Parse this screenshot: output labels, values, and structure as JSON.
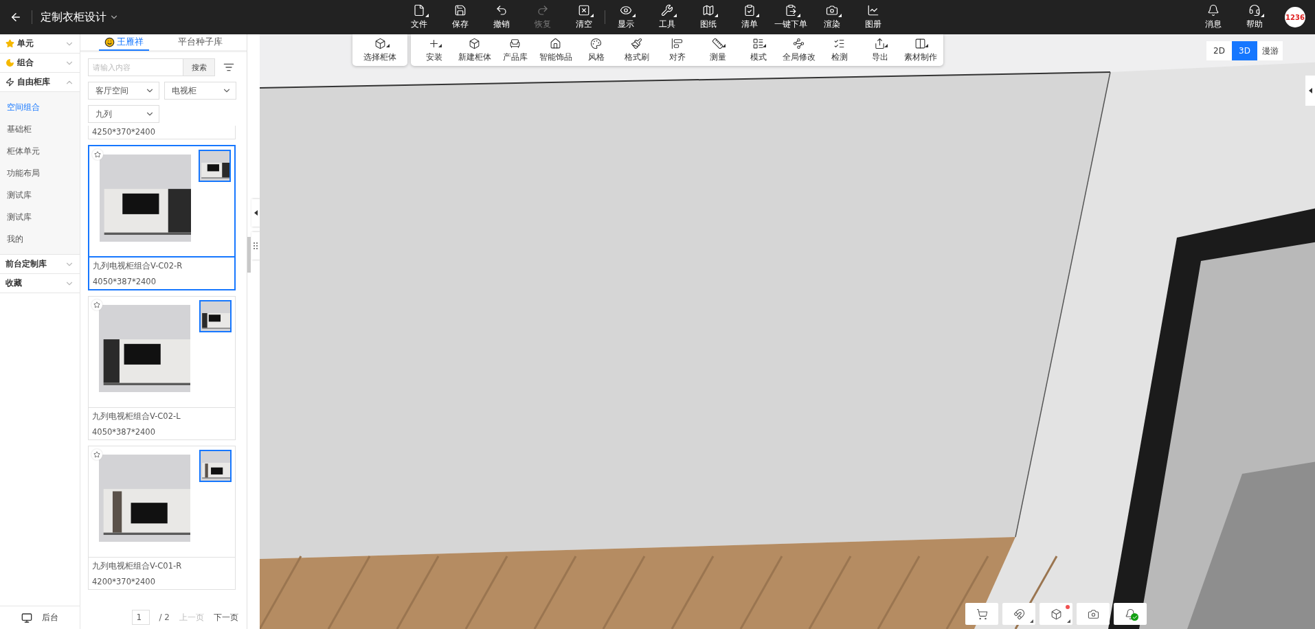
{
  "header": {
    "title": "定制衣柜设计",
    "menu_groups": [
      [
        {
          "label": "文件",
          "has_menu": true,
          "disabled": false
        },
        {
          "label": "保存",
          "has_menu": false,
          "disabled": false
        },
        {
          "label": "撤销",
          "has_menu": false,
          "disabled": false
        },
        {
          "label": "恢复",
          "has_menu": false,
          "disabled": true
        },
        {
          "label": "清空",
          "has_menu": true,
          "disabled": false
        }
      ],
      [
        {
          "label": "显示",
          "has_menu": true,
          "disabled": false
        },
        {
          "label": "工具",
          "has_menu": true,
          "disabled": false
        },
        {
          "label": "图纸",
          "has_menu": true,
          "disabled": false
        },
        {
          "label": "清单",
          "has_menu": true,
          "disabled": false
        },
        {
          "label": "一键下单",
          "has_menu": true,
          "disabled": false
        },
        {
          "label": "渲染",
          "has_menu": true,
          "disabled": false
        },
        {
          "label": "图册",
          "has_menu": false,
          "disabled": false
        }
      ]
    ],
    "right": [
      {
        "label": "消息",
        "has_menu": false
      },
      {
        "label": "帮助",
        "has_menu": true
      }
    ],
    "avatar": "1236"
  },
  "nav": {
    "sections": [
      {
        "label": "单元",
        "expanded": false
      },
      {
        "label": "组合",
        "expanded": false
      },
      {
        "label": "自由柜库",
        "expanded": true,
        "children": [
          {
            "label": "空间组合",
            "selected": true
          },
          {
            "label": "基础柜",
            "selected": false
          },
          {
            "label": "柜体单元",
            "selected": false
          },
          {
            "label": "功能布局",
            "selected": false
          },
          {
            "label": "测试库",
            "selected": false
          },
          {
            "label": "测试库",
            "selected": false
          },
          {
            "label": "我的",
            "selected": false
          }
        ]
      },
      {
        "label": "前台定制库",
        "expanded": false
      },
      {
        "label": "收藏",
        "expanded": false
      }
    ],
    "footer": "后台"
  },
  "library": {
    "tabs": [
      {
        "label": "王雁祥",
        "selected": true
      },
      {
        "label": "平台种子库",
        "selected": false
      }
    ],
    "search": {
      "placeholder": "请输入内容",
      "button": "搜索"
    },
    "filters": [
      "客厅空间",
      "电视柜",
      "九列"
    ],
    "partial_card": {
      "dims": "4250*370*2400"
    },
    "cards": [
      {
        "name": "九列电视柜组合V-C02-R",
        "dims": "4050*387*2400",
        "selected": true
      },
      {
        "name": "九列电视柜组合V-C02-L",
        "dims": "4050*387*2400",
        "selected": false
      },
      {
        "name": "九列电视柜组合V-C01-R",
        "dims": "4200*370*2400",
        "selected": false
      }
    ],
    "pagination": {
      "page": "1",
      "total": "/ 2",
      "prev": {
        "label": "上一页",
        "disabled": true
      },
      "next": {
        "label": "下一页",
        "disabled": false
      }
    }
  },
  "toolbar": {
    "groups": [
      [
        {
          "label": "选择柜体",
          "has_menu": true
        }
      ],
      [
        {
          "label": "安装",
          "has_menu": true
        },
        {
          "label": "新建柜体",
          "has_menu": false
        },
        {
          "label": "产品库",
          "has_menu": false
        },
        {
          "label": "智能饰品",
          "has_menu": false
        },
        {
          "label": "风格",
          "has_menu": false
        },
        {
          "label": "格式刷",
          "has_menu": false
        },
        {
          "label": "对齐",
          "has_menu": false
        },
        {
          "label": "测量",
          "has_menu": true
        },
        {
          "label": "模式",
          "has_menu": true
        },
        {
          "label": "全局修改",
          "has_menu": false
        },
        {
          "label": "检测",
          "has_menu": false
        },
        {
          "label": "导出",
          "has_menu": true
        },
        {
          "label": "素材制作",
          "has_menu": true
        }
      ]
    ]
  },
  "view_modes": [
    {
      "label": "2D",
      "selected": false
    },
    {
      "label": "3D",
      "selected": true
    },
    {
      "label": "漫游",
      "selected": false
    }
  ],
  "bottom_tools": [
    {
      "has_menu": false,
      "alert": false,
      "ok": false
    },
    {
      "has_menu": true,
      "alert": false,
      "ok": false
    },
    {
      "has_menu": true,
      "alert": true,
      "ok": false
    },
    {
      "has_menu": false,
      "alert": false,
      "ok": false
    },
    {
      "has_menu": false,
      "alert": false,
      "ok": true
    }
  ]
}
